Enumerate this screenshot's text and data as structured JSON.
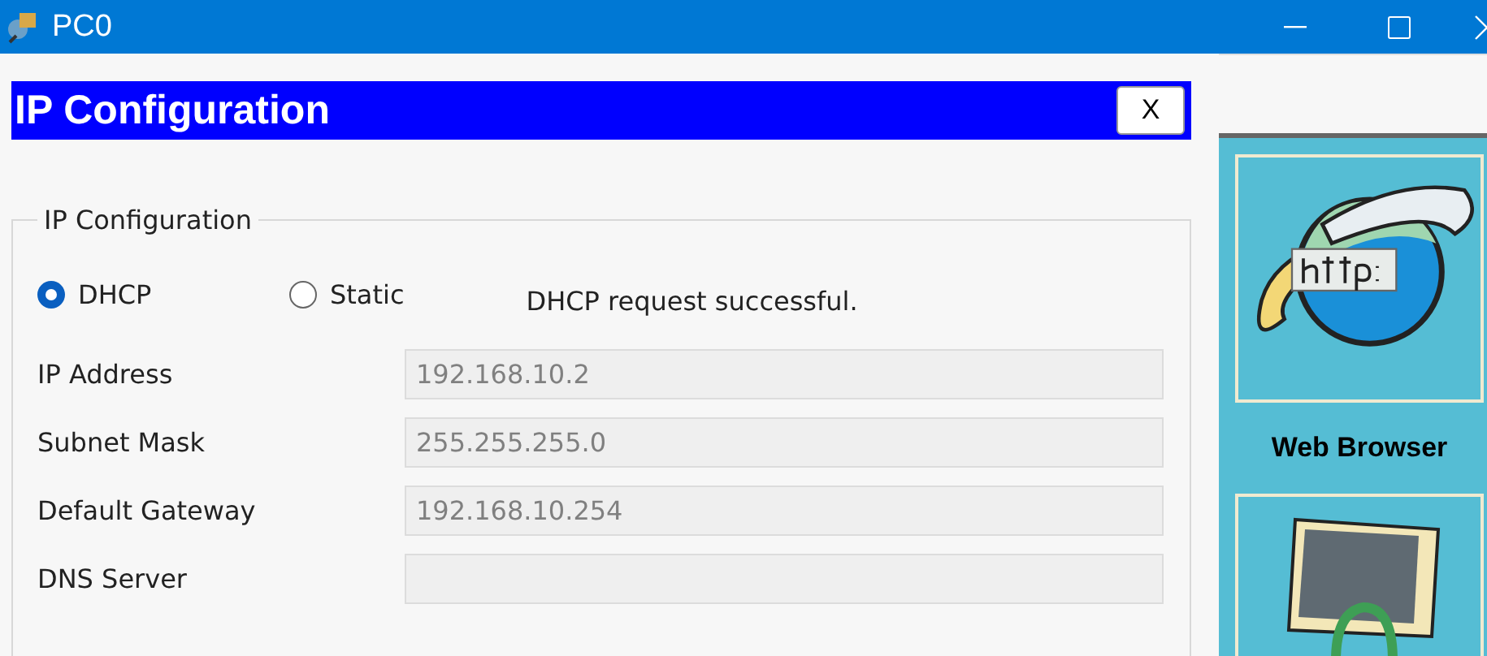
{
  "window": {
    "title": "PC0"
  },
  "dialog": {
    "title": "IP Configuration",
    "close_label": "X"
  },
  "group": {
    "legend": "IP Configuration",
    "modes": [
      {
        "label": "DHCP",
        "selected": true
      },
      {
        "label": "Static",
        "selected": false
      }
    ],
    "status": "DHCP request successful.",
    "fields": [
      {
        "label": "IP Address",
        "value": "192.168.10.2",
        "disabled": true
      },
      {
        "label": "Subnet Mask",
        "value": "255.255.255.0",
        "disabled": true
      },
      {
        "label": "Default Gateway",
        "value": "192.168.10.254",
        "disabled": true
      },
      {
        "label": "DNS Server",
        "disabled": true
      }
    ]
  },
  "apps": [
    {
      "label": "Web Browser",
      "kind": "browser"
    },
    {
      "kind": "desktop"
    }
  ]
}
